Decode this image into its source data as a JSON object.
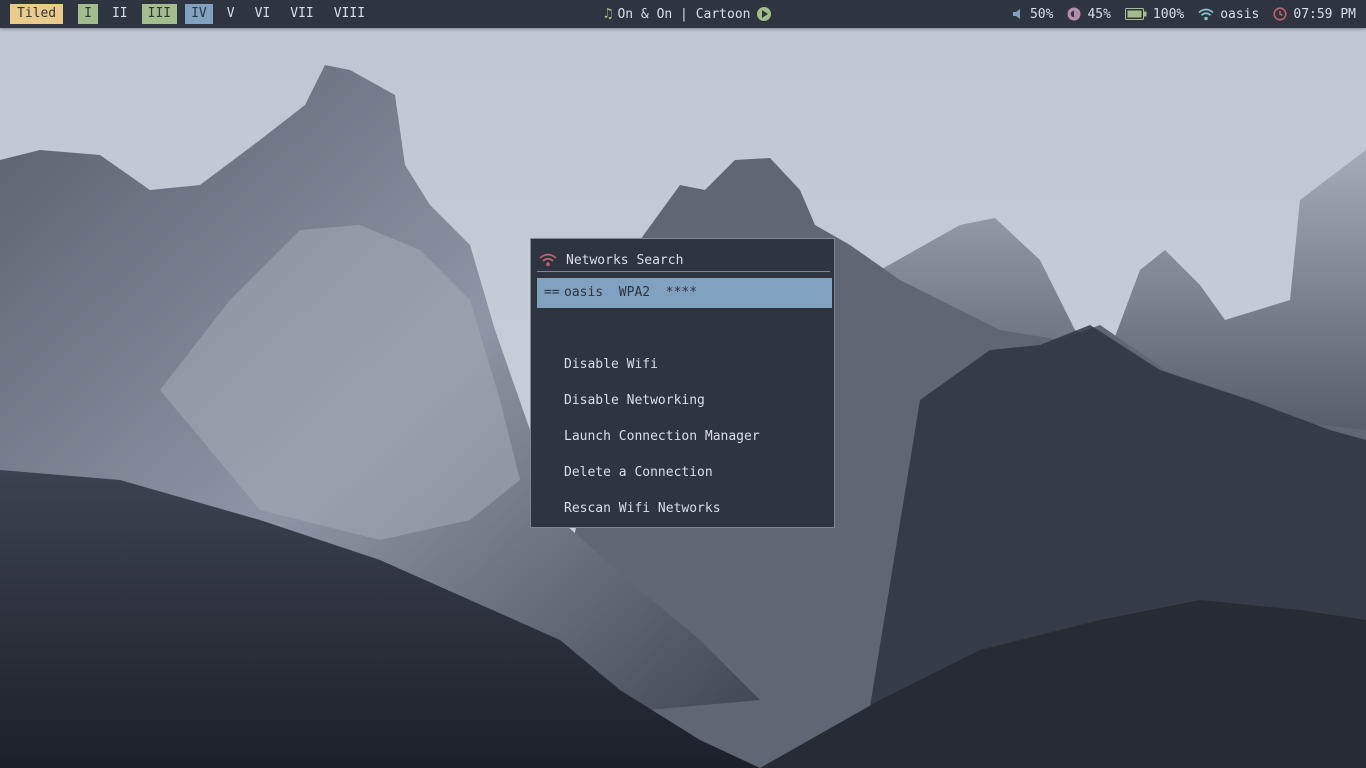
{
  "topbar": {
    "layout": "Tiled",
    "workspaces": [
      {
        "label": "I",
        "state": "occupied"
      },
      {
        "label": "II",
        "state": "empty"
      },
      {
        "label": "III",
        "state": "occupied"
      },
      {
        "label": "IV",
        "state": "active"
      },
      {
        "label": "V",
        "state": "empty"
      },
      {
        "label": "VI",
        "state": "empty"
      },
      {
        "label": "VII",
        "state": "empty"
      },
      {
        "label": "VIII",
        "state": "empty"
      }
    ],
    "music": {
      "icon": "music-note-icon",
      "title": "On & On | Cartoon",
      "control_icon": "play-icon"
    },
    "volume": {
      "icon": "speaker-icon",
      "value": "50%"
    },
    "brightness": {
      "icon": "brightness-icon",
      "value": "45%"
    },
    "battery": {
      "icon": "battery-icon",
      "value": "100%"
    },
    "network": {
      "icon": "wifi-icon",
      "value": "oasis"
    },
    "clock": {
      "icon": "clock-icon",
      "value": "07:59 PM"
    }
  },
  "menu": {
    "title": "Networks Search",
    "title_icon": "wifi-icon",
    "networks": [
      {
        "prefix": "==",
        "text": "oasis  WPA2  ****",
        "selected": true
      }
    ],
    "actions": [
      "Disable Wifi",
      "Disable Networking",
      "Launch Connection Manager",
      "Delete a Connection",
      "Rescan Wifi Networks"
    ]
  },
  "colors": {
    "bar_bg": "#2e3440",
    "foreground": "#d8dee9",
    "layout_badge": "#ebcb8b",
    "workspace_occupied": "#a3be8c",
    "workspace_active": "#81a1c1",
    "selection": "#81a1c1",
    "wifi_icon_menu": "#bf616a",
    "brightness_icon": "#b48ead",
    "battery_icon": "#a3be8c",
    "wifi_icon_bar": "#88c0d0",
    "clock_icon": "#bf616a"
  }
}
